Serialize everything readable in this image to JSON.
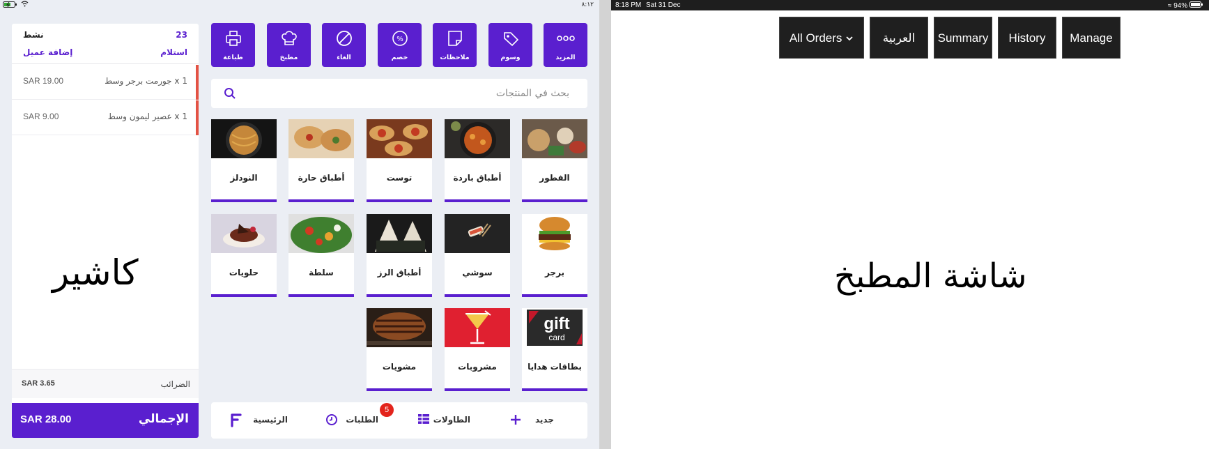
{
  "cashier": {
    "status_bar": {
      "battery_icon": "battery-charging-icon",
      "time": "٨:١٢"
    },
    "order": {
      "count": "23",
      "status": "نشط",
      "receive_label": "استلام",
      "add_customer_label": "إضافة عميل",
      "items": [
        {
          "name": "1  x  جورمت برجر وسط",
          "price": "SAR 19.00"
        },
        {
          "name": "1  x  عصير ليمون وسط",
          "price": "SAR 9.00"
        }
      ],
      "tax_label": "الضرائب",
      "tax_value": "SAR 3.65",
      "total_label": "الإجمالي",
      "total_value": "SAR 28.00"
    },
    "watermark": "كاشير",
    "actions": [
      {
        "label": "المزيد",
        "icon": "more-dots-icon"
      },
      {
        "label": "وسوم",
        "icon": "tags-icon"
      },
      {
        "label": "ملاحظات",
        "icon": "note-icon"
      },
      {
        "label": "خصم",
        "icon": "discount-icon"
      },
      {
        "label": "الغاء",
        "icon": "cancel-icon"
      },
      {
        "label": "مطبخ",
        "icon": "chef-hat-icon"
      },
      {
        "label": "طباعة",
        "icon": "printer-icon"
      }
    ],
    "search": {
      "placeholder": "بحث في المنتجات",
      "icon": "search-icon"
    },
    "categories": [
      {
        "name": "الفطور"
      },
      {
        "name": "أطباق باردة"
      },
      {
        "name": "توست"
      },
      {
        "name": "أطباق حارة"
      },
      {
        "name": "النودلز"
      },
      {
        "name": "برجر"
      },
      {
        "name": "سوشي"
      },
      {
        "name": "أطباق الرز"
      },
      {
        "name": "سلطة"
      },
      {
        "name": "حلويات"
      },
      {
        "name": "بطاقات هدايا",
        "image_text": "gift",
        "image_subtext": "card"
      },
      {
        "name": "مشروبات"
      },
      {
        "name": "مشويات"
      }
    ],
    "bottom_nav": {
      "new_label": "جديد",
      "tables_label": "الطاولات",
      "orders_label": "الطلبات",
      "orders_badge": "5",
      "home_label": "الرئيسية"
    },
    "colors": {
      "accent": "#5a1fcf",
      "item_bar": "#e35244",
      "badge": "#e3241c"
    }
  },
  "kitchen": {
    "status_bar": {
      "time": "8:18 PM",
      "date": "Sat 31 Dec",
      "battery": "94%"
    },
    "buttons": {
      "manage": "Manage",
      "history": "History",
      "summary": "Summary",
      "language": "العربية",
      "all_orders": "All Orders"
    },
    "watermark": "شاشة المطبخ"
  }
}
